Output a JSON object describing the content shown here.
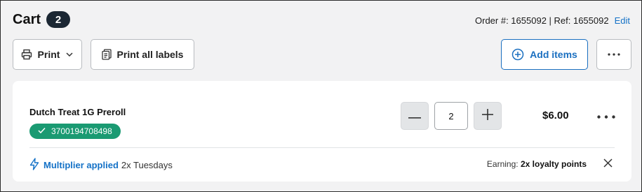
{
  "header": {
    "title": "Cart",
    "count": "2",
    "order_label": "Order #: 1655092 | Ref: 1655092",
    "edit_label": "Edit"
  },
  "toolbar": {
    "print_label": "Print",
    "print_all_labels": "Print all labels",
    "add_items_label": "Add items",
    "more_icon": "ellipsis-horizontal-icon"
  },
  "item": {
    "name": "Dutch Treat 1G Preroll",
    "sku": "3700194708498",
    "quantity": "2",
    "price": "$6.00",
    "multiplier_label": "Multiplier applied",
    "multiplier_detail": "2x Tuesdays",
    "earning_prefix": "Earning:",
    "earning_points": "2x loyalty points"
  },
  "colors": {
    "accent": "#1572c7",
    "sku_badge": "#1a9a72",
    "count_badge": "#1b2733"
  }
}
